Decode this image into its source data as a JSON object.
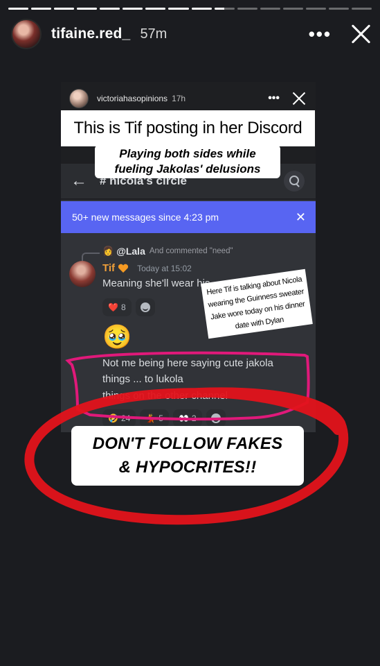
{
  "story": {
    "segments_total": 16,
    "active_segment": 9,
    "active_progress": 0.5,
    "username": "tifaine.red_",
    "time": "57m",
    "more_label": "•••"
  },
  "inner": {
    "username": "victoriahasopinions",
    "time": "17h",
    "more_label": "•••",
    "channel_name": "# nicola's circle",
    "back_label": "←",
    "new_messages": "50+ new messages since 4:23 pm",
    "new_messages_close": "✕",
    "reply_name": "@Lala",
    "reply_extra": "And commented \"need\"",
    "author": "Tif",
    "timestamp": "Today at 15:02",
    "message1": "Meaning she'll wear his",
    "reaction1": {
      "emoji": "❤️",
      "count": "8"
    },
    "big_emoji": "🥹",
    "message2": [
      "Not me being here saying cute jakola",
      "things ... to lukola",
      "things on the other channel"
    ],
    "reactions2": [
      {
        "emoji": "🤣",
        "count": "24"
      },
      {
        "emoji": "💃",
        "count": "5"
      },
      {
        "emoji": "👀",
        "count": "2"
      }
    ]
  },
  "overlays": {
    "title": "This is Tif posting in her Discord",
    "subtitle": "Playing both sides while fueling Jakolas' delusions",
    "note": "Here Tif is talking about Nicola wearing the Guinness sweater Jake wore today on his dinner date with Dylan",
    "callout_line1": "DON'T FOLLOW FAKES",
    "callout_line2": "& HYPOCRITES!!"
  },
  "colors": {
    "background": "#1b1c20",
    "discord_bg": "#313338",
    "blurple": "#5865f2",
    "highlight_pink": "#e0197a",
    "circle_red": "#e3131b"
  }
}
